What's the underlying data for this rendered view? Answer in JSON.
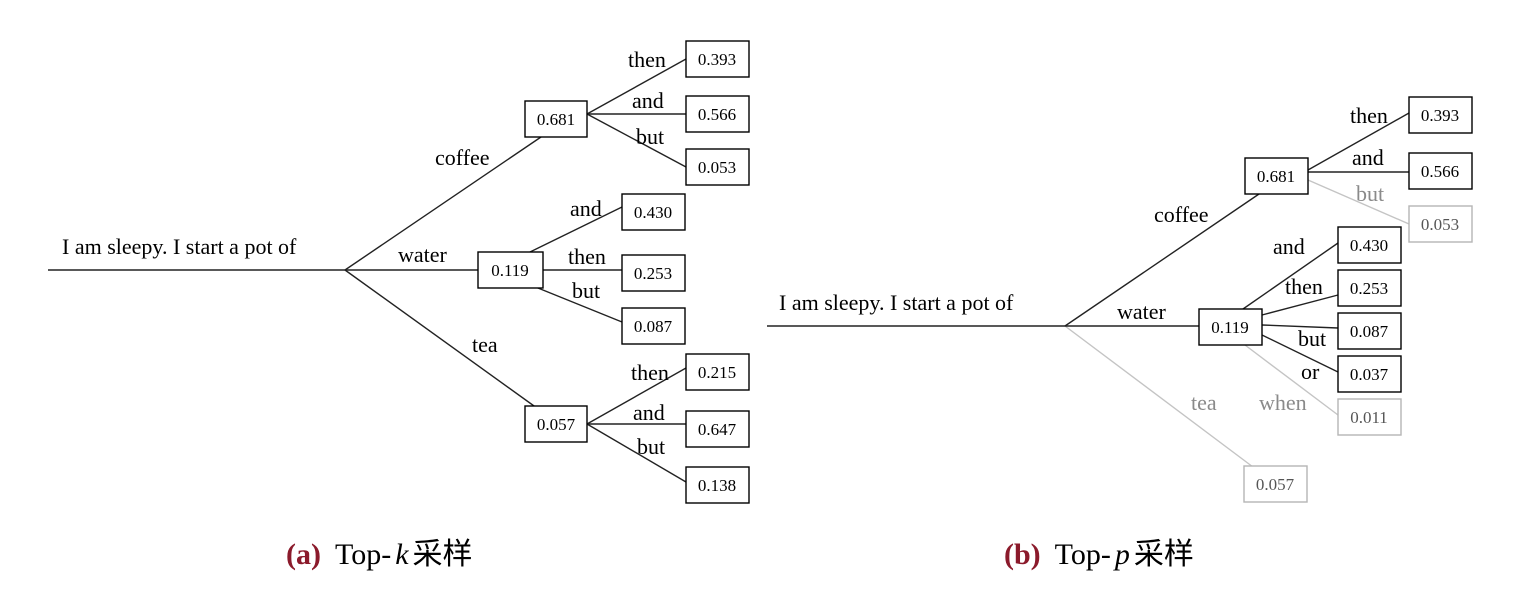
{
  "prompt_text": "I am sleepy. I start a pot of",
  "panel_a": {
    "letter": "(a)",
    "title_prefix": "Top-",
    "title_var": "k",
    "title_suffix": " 采样",
    "first_level": [
      {
        "word": "coffee",
        "prob": "0.681",
        "children": [
          {
            "word": "then",
            "prob": "0.393"
          },
          {
            "word": "and",
            "prob": "0.566"
          },
          {
            "word": "but",
            "prob": "0.053"
          }
        ]
      },
      {
        "word": "water",
        "prob": "0.119",
        "children": [
          {
            "word": "and",
            "prob": "0.430"
          },
          {
            "word": "then",
            "prob": "0.253"
          },
          {
            "word": "but",
            "prob": "0.087"
          }
        ]
      },
      {
        "word": "tea",
        "prob": "0.057",
        "children": [
          {
            "word": "then",
            "prob": "0.215"
          },
          {
            "word": "and",
            "prob": "0.647"
          },
          {
            "word": "but",
            "prob": "0.138"
          }
        ]
      }
    ]
  },
  "panel_b": {
    "letter": "(b)",
    "title_prefix": "Top-",
    "title_var": "p",
    "title_suffix": " 采样",
    "first_level": [
      {
        "word": "coffee",
        "prob": "0.681",
        "pruned": false,
        "children": [
          {
            "word": "then",
            "prob": "0.393",
            "pruned": false
          },
          {
            "word": "and",
            "prob": "0.566",
            "pruned": false
          },
          {
            "word": "but",
            "prob": "0.053",
            "pruned": true
          }
        ]
      },
      {
        "word": "water",
        "prob": "0.119",
        "pruned": false,
        "children": [
          {
            "word": "and",
            "prob": "0.430",
            "pruned": false
          },
          {
            "word": "then",
            "prob": "0.253",
            "pruned": false
          },
          {
            "word": "but",
            "prob": "0.087",
            "pruned": false
          },
          {
            "word": "or",
            "prob": "0.037",
            "pruned": false
          },
          {
            "word": "when",
            "prob": "0.011",
            "pruned": true
          }
        ]
      },
      {
        "word": "tea",
        "prob": "0.057",
        "pruned": true,
        "children": []
      }
    ]
  },
  "colors": {
    "caption_letter": "#8b1a2b",
    "pruned_line": "#c4c4c4",
    "pruned_text": "#8a8a8a"
  }
}
